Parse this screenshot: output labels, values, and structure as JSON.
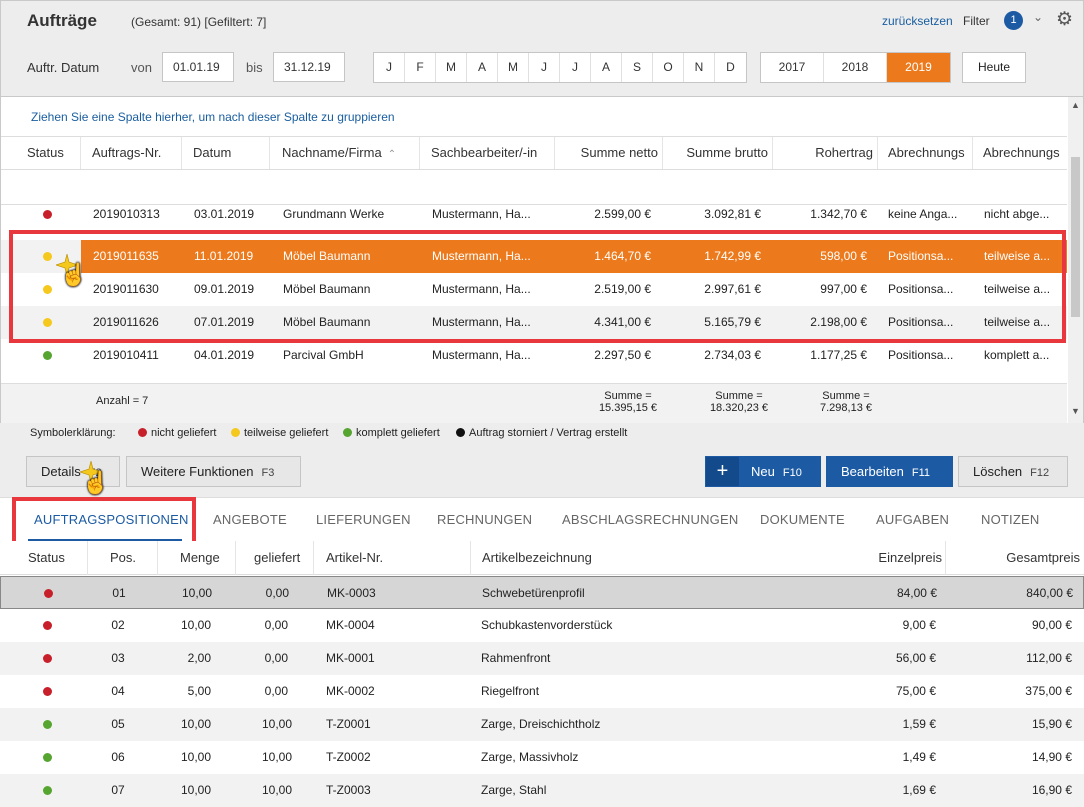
{
  "header": {
    "title": "Aufträge",
    "count": "(Gesamt: 91) [Gefiltert: 7]",
    "reset_label": "zurücksetzen",
    "filter_label": "Filter",
    "filter_badge": "1",
    "date_label": "Auftr. Datum",
    "von_label": "von",
    "bis_label": "bis",
    "date_from": "01.01.19",
    "date_to": "31.12.19",
    "months": [
      "J",
      "F",
      "M",
      "A",
      "M",
      "J",
      "J",
      "A",
      "S",
      "O",
      "N",
      "D"
    ],
    "years": [
      "2017",
      "2018",
      "2019"
    ],
    "active_year": "2019",
    "today_label": "Heute"
  },
  "orders": {
    "group_hint": "Ziehen Sie eine Spalte hierher, um nach dieser Spalte zu gruppieren",
    "columns": [
      "Status",
      "Auftrags-Nr.",
      "Datum",
      "Nachname/Firma",
      "Sachbearbeiter/-in",
      "Summe netto",
      "Summe brutto",
      "Rohertrag",
      "Abrechnungs",
      "Abrechnungs"
    ],
    "rows": [
      {
        "status": "red",
        "nr": "2019010313",
        "datum": "03.01.2019",
        "name": "Grundmann Werke",
        "sb": "Mustermann, Ha...",
        "netto": "2.599,00 €",
        "brutto": "3.092,81 €",
        "roh": "1.342,70 €",
        "abr1": "keine Anga...",
        "abr2": "nicht abge..."
      },
      {
        "status": "yellow",
        "nr": "2019011635",
        "datum": "11.01.2019",
        "name": "Möbel Baumann",
        "sb": "Mustermann, Ha...",
        "netto": "1.464,70 €",
        "brutto": "1.742,99 €",
        "roh": "598,00 €",
        "abr1": "Positionsa...",
        "abr2": "teilweise a..."
      },
      {
        "status": "yellow",
        "nr": "2019011630",
        "datum": "09.01.2019",
        "name": "Möbel Baumann",
        "sb": "Mustermann, Ha...",
        "netto": "2.519,00 €",
        "brutto": "2.997,61 €",
        "roh": "997,00 €",
        "abr1": "Positionsa...",
        "abr2": "teilweise a..."
      },
      {
        "status": "yellow",
        "nr": "2019011626",
        "datum": "07.01.2019",
        "name": "Möbel Baumann",
        "sb": "Mustermann, Ha...",
        "netto": "4.341,00 €",
        "brutto": "5.165,79 €",
        "roh": "2.198,00 €",
        "abr1": "Positionsa...",
        "abr2": "teilweise a..."
      },
      {
        "status": "green",
        "nr": "2019010411",
        "datum": "04.01.2019",
        "name": "Parcival GmbH",
        "sb": "Mustermann, Ha...",
        "netto": "2.297,50 €",
        "brutto": "2.734,03 €",
        "roh": "1.177,25 €",
        "abr1": "Positionsa...",
        "abr2": "komplett a..."
      }
    ],
    "anzahl": "Anzahl = 7",
    "sum_label": "Summe =",
    "sum_netto": "15.395,15 €",
    "sum_brutto": "18.320,23 €",
    "sum_roh": "7.298,13 €"
  },
  "legend": {
    "title": "Symbolerklärung:",
    "items": [
      {
        "color": "#c8202a",
        "label": "nicht geliefert"
      },
      {
        "color": "#f5c81e",
        "label": "teilweise geliefert"
      },
      {
        "color": "#55a530",
        "label": "komplett geliefert"
      },
      {
        "color": "#111111",
        "label": "Auftrag storniert / Vertrag erstellt"
      }
    ]
  },
  "buttons": {
    "details": "Details",
    "details_key": "F2",
    "more": "Weitere Funktionen",
    "more_key": "F3",
    "new": "Neu",
    "new_key": "F10",
    "edit": "Bearbeiten",
    "edit_key": "F11",
    "delete": "Löschen",
    "delete_key": "F12"
  },
  "tabs": [
    "AUFTRAGSPOSITIONEN",
    "ANGEBOTE",
    "LIEFERUNGEN",
    "RECHNUNGEN",
    "ABSCHLAGSRECHNUNGEN",
    "DOKUMENTE",
    "AUFGABEN",
    "NOTIZEN"
  ],
  "positions": {
    "columns": [
      "Status",
      "Pos.",
      "Menge",
      "geliefert",
      "Artikel-Nr.",
      "Artikelbezeichnung",
      "Einzelpreis",
      "Gesamtpreis"
    ],
    "rows": [
      {
        "status": "red",
        "pos": "01",
        "menge": "10,00",
        "geliefert": "0,00",
        "art": "MK-0003",
        "bez": "Schwebetürenprofil",
        "ep": "84,00 €",
        "gp": "840,00 €"
      },
      {
        "status": "red",
        "pos": "02",
        "menge": "10,00",
        "geliefert": "0,00",
        "art": "MK-0004",
        "bez": "Schubkastenvorderstück",
        "ep": "9,00 €",
        "gp": "90,00 €"
      },
      {
        "status": "red",
        "pos": "03",
        "menge": "2,00",
        "geliefert": "0,00",
        "art": "MK-0001",
        "bez": "Rahmenfront",
        "ep": "56,00 €",
        "gp": "112,00 €"
      },
      {
        "status": "red",
        "pos": "04",
        "menge": "5,00",
        "geliefert": "0,00",
        "art": "MK-0002",
        "bez": "Riegelfront",
        "ep": "75,00 €",
        "gp": "375,00 €"
      },
      {
        "status": "green",
        "pos": "05",
        "menge": "10,00",
        "geliefert": "10,00",
        "art": "T-Z0001",
        "bez": "Zarge, Dreischichtholz",
        "ep": "1,59 €",
        "gp": "15,90 €"
      },
      {
        "status": "green",
        "pos": "06",
        "menge": "10,00",
        "geliefert": "10,00",
        "art": "T-Z0002",
        "bez": "Zarge, Massivholz",
        "ep": "1,49 €",
        "gp": "14,90 €"
      },
      {
        "status": "green",
        "pos": "07",
        "menge": "10,00",
        "geliefert": "10,00",
        "art": "T-Z0003",
        "bez": "Zarge, Stahl",
        "ep": "1,69 €",
        "gp": "16,90 €"
      }
    ]
  },
  "colors": {
    "red": "#c8202a",
    "yellow": "#f5c81e",
    "green": "#55a530",
    "accent": "#ec7a1c",
    "blue": "#1c5ba4"
  }
}
